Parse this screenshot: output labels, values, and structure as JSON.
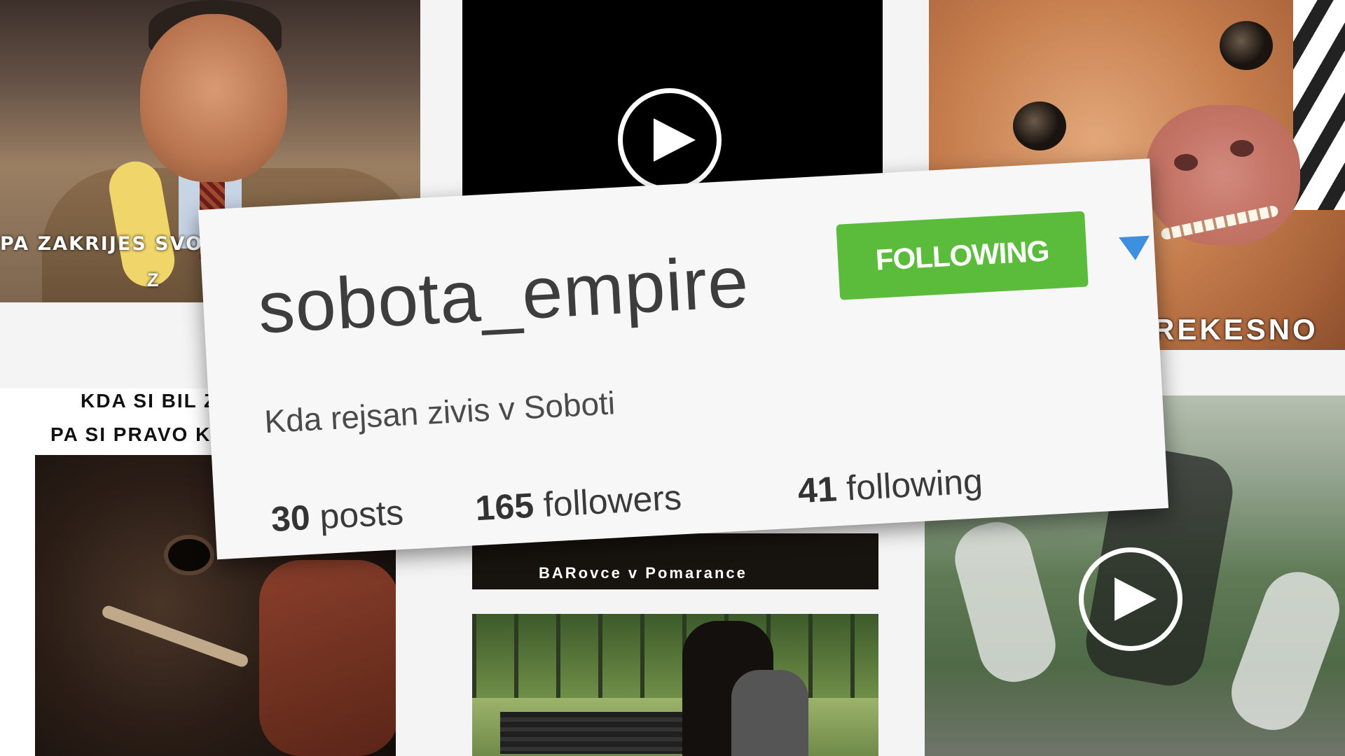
{
  "background_tiles": {
    "top_left_caption_line1": "PA ZAKRIJES SVO",
    "top_left_caption_line2": "Z",
    "top_right_caption": "REKESNO",
    "bottom_left_caption_line1": "KDA SI BIL Z",
    "bottom_left_caption_line2": "PA SI PRAVO KA",
    "bottom_center_caption": "BARovce v Pomarance"
  },
  "profile": {
    "username": "sobota_empire",
    "follow_label": "FOLLOWING",
    "bio": "Kda rejsan zivis v Soboti",
    "stats": {
      "posts_count": "30",
      "posts_label": "posts",
      "followers_count": "165",
      "followers_label": "followers",
      "following_count": "41",
      "following_label": "following"
    }
  },
  "icons": {
    "play": "play-icon",
    "dropdown": "triangle-down-icon"
  },
  "colors": {
    "following_button": "#5bbb3a",
    "dropdown_arrow": "#3d8fe0"
  }
}
